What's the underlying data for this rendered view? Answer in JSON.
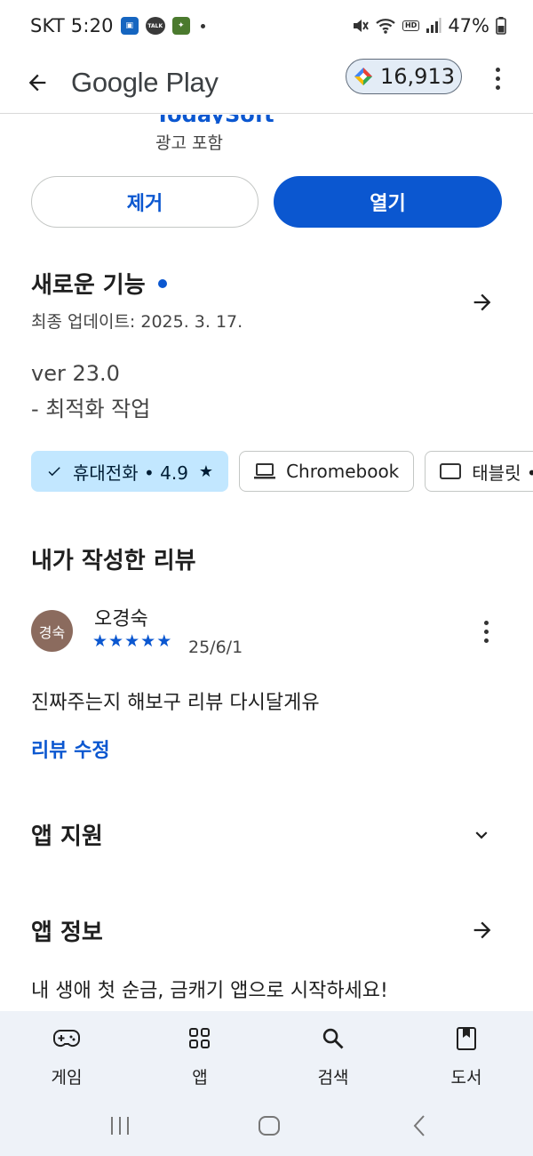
{
  "status_bar": {
    "carrier_time": "SKT 5:20",
    "notif_talk": "TALK",
    "battery": "47%",
    "hd_voice": "HD"
  },
  "app_bar": {
    "title": "Google Play",
    "points": "16,913"
  },
  "app": {
    "developer_partial": "TodaySoft",
    "ads_label": "광고 포함",
    "remove_label": "제거",
    "open_label": "열기"
  },
  "whats_new": {
    "title": "새로운 기능",
    "updated": "최종 업데이트: 2025. 3. 17.",
    "version": "ver 23.0",
    "note": "- 최적화 작업"
  },
  "device_chips": [
    {
      "label": "휴대전화 • 4.9",
      "selected": true
    },
    {
      "label": "Chromebook",
      "selected": false
    },
    {
      "label": "태블릿 •",
      "selected": false
    }
  ],
  "review": {
    "section_title": "내가 작성한 리뷰",
    "avatar_text": "경숙",
    "reviewer": "오경숙",
    "stars": 5,
    "date": "25/6/1",
    "text": "진짜주는지 해보구 리뷰 다시달게유",
    "edit_label": "리뷰 수정"
  },
  "sections": {
    "app_support": "앱 지원",
    "app_info": "앱 정보",
    "app_desc": "내 생애 첫 순금, 금캐기 앱으로 시작하세요!"
  },
  "bottom_nav": [
    {
      "label": "게임",
      "icon": "gamepad-icon"
    },
    {
      "label": "앱",
      "icon": "apps-grid-icon"
    },
    {
      "label": "검색",
      "icon": "search-icon"
    },
    {
      "label": "도서",
      "icon": "book-icon"
    }
  ],
  "colors": {
    "accent": "#0b57d0",
    "chip_selected": "#c2e7ff",
    "nav_bg": "#eef2f8",
    "avatar_bg": "#8b6b5e"
  }
}
